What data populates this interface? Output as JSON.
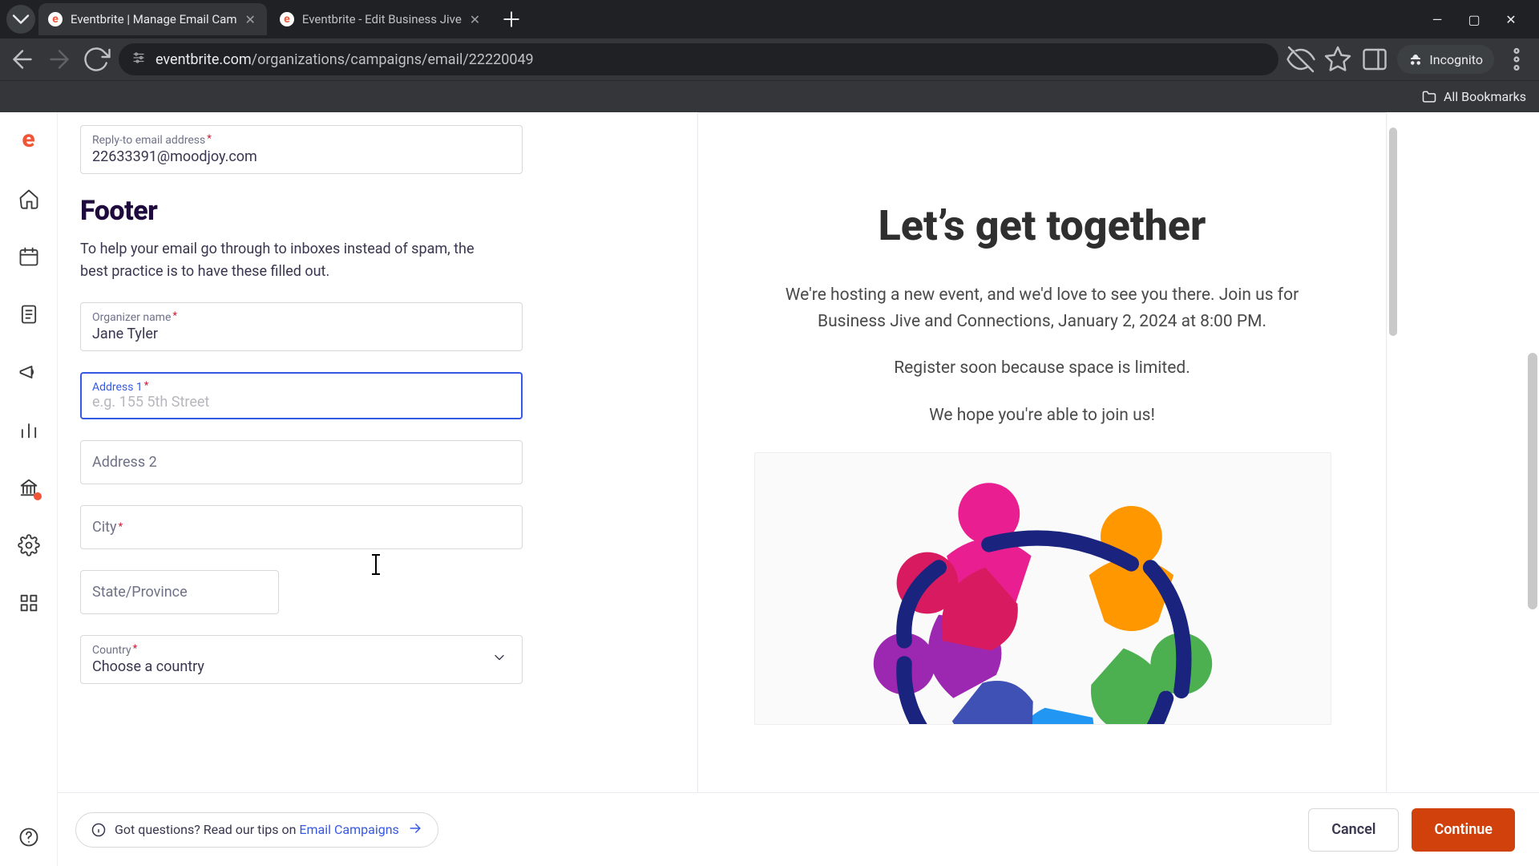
{
  "browser": {
    "tabs": [
      {
        "title": "Eventbrite | Manage Email Cam",
        "active": true
      },
      {
        "title": "Eventbrite - Edit Business Jive",
        "active": false
      }
    ],
    "url_host": "eventbrite.com",
    "url_path": "/organizations/campaigns/email/22220049",
    "incognito_label": "Incognito",
    "all_bookmarks": "All Bookmarks"
  },
  "form": {
    "reply_to": {
      "label": "Reply-to email address",
      "value": "22633391@moodjoy.com"
    },
    "section_title": "Footer",
    "section_desc": "To help your email go through to inboxes instead of spam, the best practice is to have these filled out.",
    "organizer": {
      "label": "Organizer name",
      "value": "Jane Tyler"
    },
    "address1": {
      "label": "Address 1",
      "placeholder": "e.g. 155 5th Street",
      "value": ""
    },
    "address2": {
      "label": "Address 2"
    },
    "city": {
      "label": "City"
    },
    "state": {
      "label": "State/Province"
    },
    "country": {
      "label": "Country",
      "value": "Choose a country"
    }
  },
  "preview": {
    "title": "Let’s get together",
    "p1": "We're hosting a new event, and we'd love to see you there. Join us for Business Jive and Connections, January 2, 2024 at 8:00 PM.",
    "p2": "Register soon because space is limited.",
    "p3": "We hope you're able to join us!"
  },
  "bottom": {
    "tips_prefix": "Got questions? Read our tips on ",
    "tips_link": "Email Campaigns",
    "cancel": "Cancel",
    "continue": "Continue"
  }
}
